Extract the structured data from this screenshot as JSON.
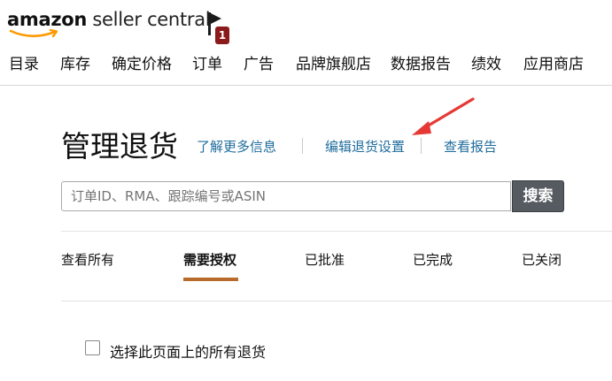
{
  "header": {
    "logo": {
      "brand": "amazon",
      "product": " seller central"
    },
    "notifications": {
      "count": "1"
    },
    "nav": [
      "目录",
      "库存",
      "确定价格",
      "订单",
      "广告",
      "品牌旗舰店",
      "数据报告",
      "绩效",
      "应用商店"
    ]
  },
  "main": {
    "title": "管理退货",
    "links": {
      "learn_more": "了解更多信息",
      "edit_settings": "编辑退货设置",
      "view_reports": "查看报告"
    },
    "search": {
      "placeholder": "订单ID、RMA、跟踪编号或ASIN",
      "button": "搜索"
    },
    "tabs": [
      {
        "label": "查看所有",
        "active": false
      },
      {
        "label": "需要授权",
        "active": true
      },
      {
        "label": "已批准",
        "active": false
      },
      {
        "label": "已完成",
        "active": false
      },
      {
        "label": "已关闭",
        "active": false
      }
    ],
    "select_all_label": "选择此页面上的所有退货"
  },
  "colors": {
    "link": "#1f6c9c",
    "active_tab_underline": "#b86b2a",
    "search_button": "#555b61",
    "annotation_arrow": "#e53935",
    "badge": "#8b1a1a"
  }
}
